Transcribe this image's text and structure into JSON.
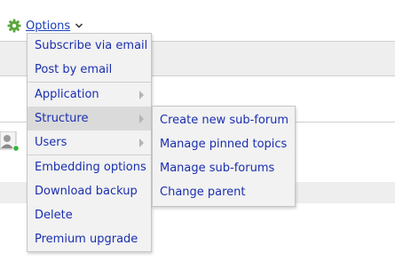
{
  "options": {
    "label": "Options"
  },
  "icons": {
    "gear": "gear-icon",
    "chevron": "chevron-down-icon",
    "avatar": "user-avatar-icon",
    "submenu_arrow": "chevron-right-icon"
  },
  "colors": {
    "link": "#1a2fb0",
    "gear": "#5aa63d",
    "menu_bg": "#f2f2f2",
    "active_bg": "#dadada",
    "status_online": "#35b535"
  },
  "menu": {
    "group1": [
      {
        "label": "Subscribe via email"
      },
      {
        "label": "Post by email"
      }
    ],
    "group2": [
      {
        "label": "Application",
        "has_submenu": true
      },
      {
        "label": "Structure",
        "has_submenu": true,
        "active": true
      },
      {
        "label": "Users",
        "has_submenu": true
      }
    ],
    "group3": [
      {
        "label": "Embedding options"
      },
      {
        "label": "Download backup"
      },
      {
        "label": "Delete"
      },
      {
        "label": "Premium upgrade"
      }
    ]
  },
  "submenu": {
    "items": [
      {
        "label": "Create new sub-forum"
      },
      {
        "label": "Manage pinned topics"
      },
      {
        "label": "Manage sub-forums"
      },
      {
        "label": "Change parent"
      }
    ]
  }
}
